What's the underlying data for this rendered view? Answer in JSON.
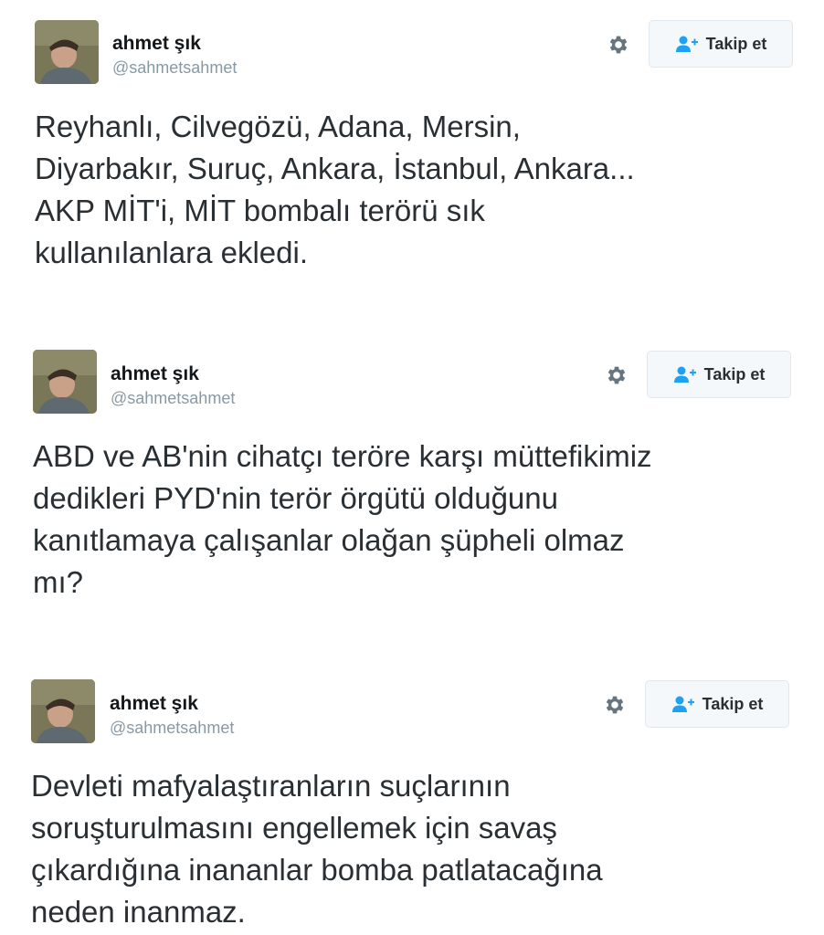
{
  "tweets": [
    {
      "name": "ahmet şık",
      "handle": "@sahmetsahmet",
      "follow_label": "Takip et",
      "lines": [
        "Reyhanlı, Cilvegözü, Adana, Mersin,",
        "Diyarbakır, Suruç, Ankara, İstanbul, Ankara...",
        "AKP MİT'i, MİT bombalı terörü sık",
        "kullanılanlara ekledi."
      ]
    },
    {
      "name": "ahmet şık",
      "handle": "@sahmetsahmet",
      "follow_label": "Takip et",
      "lines": [
        "ABD ve AB'nin cihatçı teröre karşı müttefikimiz",
        "dedikleri PYD'nin terör örgütü olduğunu",
        "kanıtlamaya çalışanlar olağan şüpheli olmaz",
        "mı?"
      ]
    },
    {
      "name": "ahmet şık",
      "handle": "@sahmetsahmet",
      "follow_label": "Takip et",
      "lines": [
        "Devleti mafyalaştıranların suçlarının",
        "soruşturulmasını engellemek için savaş",
        "çıkardığına inananlar bomba patlatacağına",
        "neden inanmaz."
      ]
    }
  ],
  "icons": {
    "gear": "gear-icon",
    "follow": "add-user-icon",
    "avatar": "profile-photo"
  },
  "colors": {
    "name": "#14171a",
    "handle": "#8899a6",
    "text": "#292f33",
    "follow_icon": "#1da1f2",
    "gear": "#8899a6"
  }
}
